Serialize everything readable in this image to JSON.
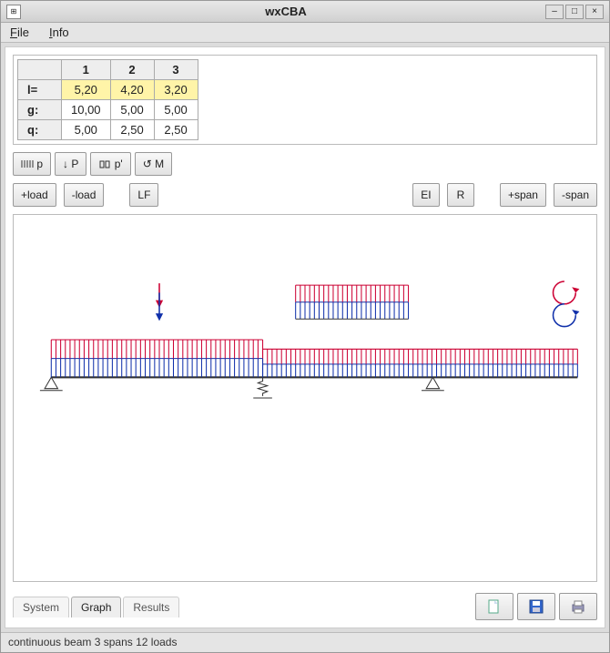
{
  "window": {
    "title": "wxCBA"
  },
  "menu": {
    "file": "File",
    "info": "Info"
  },
  "table": {
    "cols": [
      "1",
      "2",
      "3"
    ],
    "rows": [
      {
        "head": "l=",
        "cells": [
          "5,20",
          "4,20",
          "3,20"
        ],
        "highlight": true
      },
      {
        "head": "g:",
        "cells": [
          "10,00",
          "5,00",
          "5,00"
        ],
        "highlight": false
      },
      {
        "head": "q:",
        "cells": [
          "5,00",
          "2,50",
          "2,50"
        ],
        "highlight": false
      }
    ]
  },
  "loadtypes": {
    "p_dist": "p",
    "p_point": "P",
    "p_prime": "p'",
    "m": "M"
  },
  "buttons": {
    "add_load": "+load",
    "del_load": "-load",
    "lf": "LF",
    "ei": "EI",
    "r": "R",
    "add_span": "+span",
    "del_span": "-span"
  },
  "tabs": {
    "system": "System",
    "graph": "Graph",
    "results": "Results",
    "active": "Graph"
  },
  "icons": {
    "new": "new-document-icon",
    "save": "save-icon",
    "print": "print-icon"
  },
  "status": "continuous beam 3 spans 12 loads",
  "colors": {
    "red": "#cc0033",
    "blue": "#1030aa",
    "beam": "#333"
  }
}
